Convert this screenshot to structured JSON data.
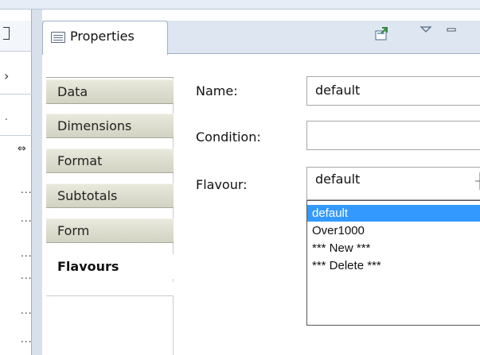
{
  "view": {
    "title": "Properties"
  },
  "tabs": [
    {
      "label": "Data",
      "active": false
    },
    {
      "label": "Dimensions",
      "active": false
    },
    {
      "label": "Format",
      "active": false
    },
    {
      "label": "Subtotals",
      "active": false
    },
    {
      "label": "Form",
      "active": false
    },
    {
      "label": "Flavours",
      "active": true
    }
  ],
  "form": {
    "name_label": "Name:",
    "name_value": "default",
    "condition_label": "Condition:",
    "condition_value": "",
    "flavour_label": "Flavour:",
    "flavour_value": "default"
  },
  "flavour_options": [
    {
      "label": "default",
      "selected": true
    },
    {
      "label": "Over1000",
      "selected": false
    },
    {
      "label": "*** New ***",
      "selected": false
    },
    {
      "label": "*** Delete ***",
      "selected": false
    }
  ],
  "left_view": {
    "dots": [
      "...",
      "...",
      "...",
      "...",
      "...",
      "..."
    ]
  },
  "colors": {
    "selection": "#3399ff",
    "tab_bg": "#d3d3c3",
    "header_bg": "#dde6f1"
  },
  "icons": [
    "properties-icon",
    "pin-icon",
    "view-menu-icon",
    "minimize-icon",
    "chevron-right-icon",
    "link-icon"
  ]
}
